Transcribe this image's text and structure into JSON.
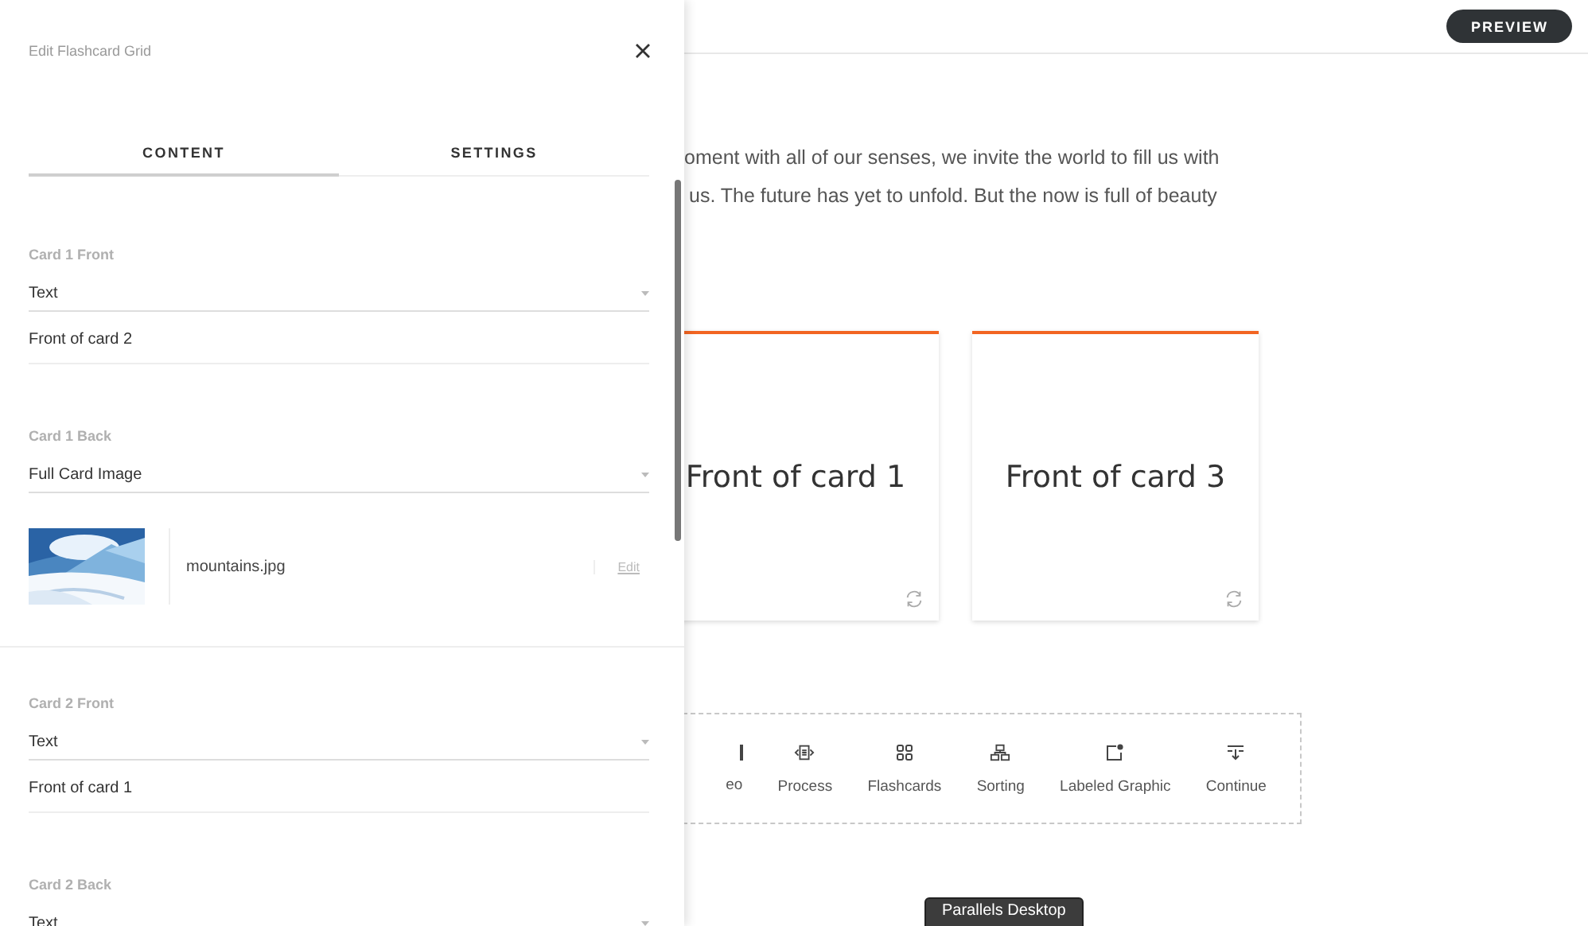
{
  "drawer": {
    "title": "Edit Flashcard Grid",
    "tabs": [
      {
        "label": "CONTENT",
        "selected": true
      },
      {
        "label": "SETTINGS",
        "selected": false
      }
    ],
    "sections": [
      {
        "label": "Card 1 Front",
        "select": "Text",
        "kind": "text",
        "value": "Front of card 2"
      },
      {
        "label": "Card 1 Back",
        "select": "Full Card Image",
        "file": "mountains.jpg",
        "action": "Edit"
      },
      {
        "label": "Card 2 Front",
        "select": "Text",
        "kind": "text",
        "value": "Front of card 1"
      },
      {
        "label": "Card 2 Back",
        "select": "Text",
        "kind": "none"
      }
    ]
  },
  "main": {
    "preview_button": "PREVIEW",
    "paragraph_lines": [
      "oment with all of our senses, we invite the world to fill us with",
      "us. The future has yet to unfold. But the now is full of beauty"
    ],
    "cards": [
      {
        "text": "Front of card 1"
      },
      {
        "text": "Front of card 3"
      }
    ],
    "blocks": [
      {
        "label": "eo"
      },
      {
        "label": "Process"
      },
      {
        "label": "Flashcards"
      },
      {
        "label": "Sorting"
      },
      {
        "label": "Labeled Graphic"
      },
      {
        "label": "Continue"
      }
    ],
    "tooltip": "Parallels Desktop"
  }
}
